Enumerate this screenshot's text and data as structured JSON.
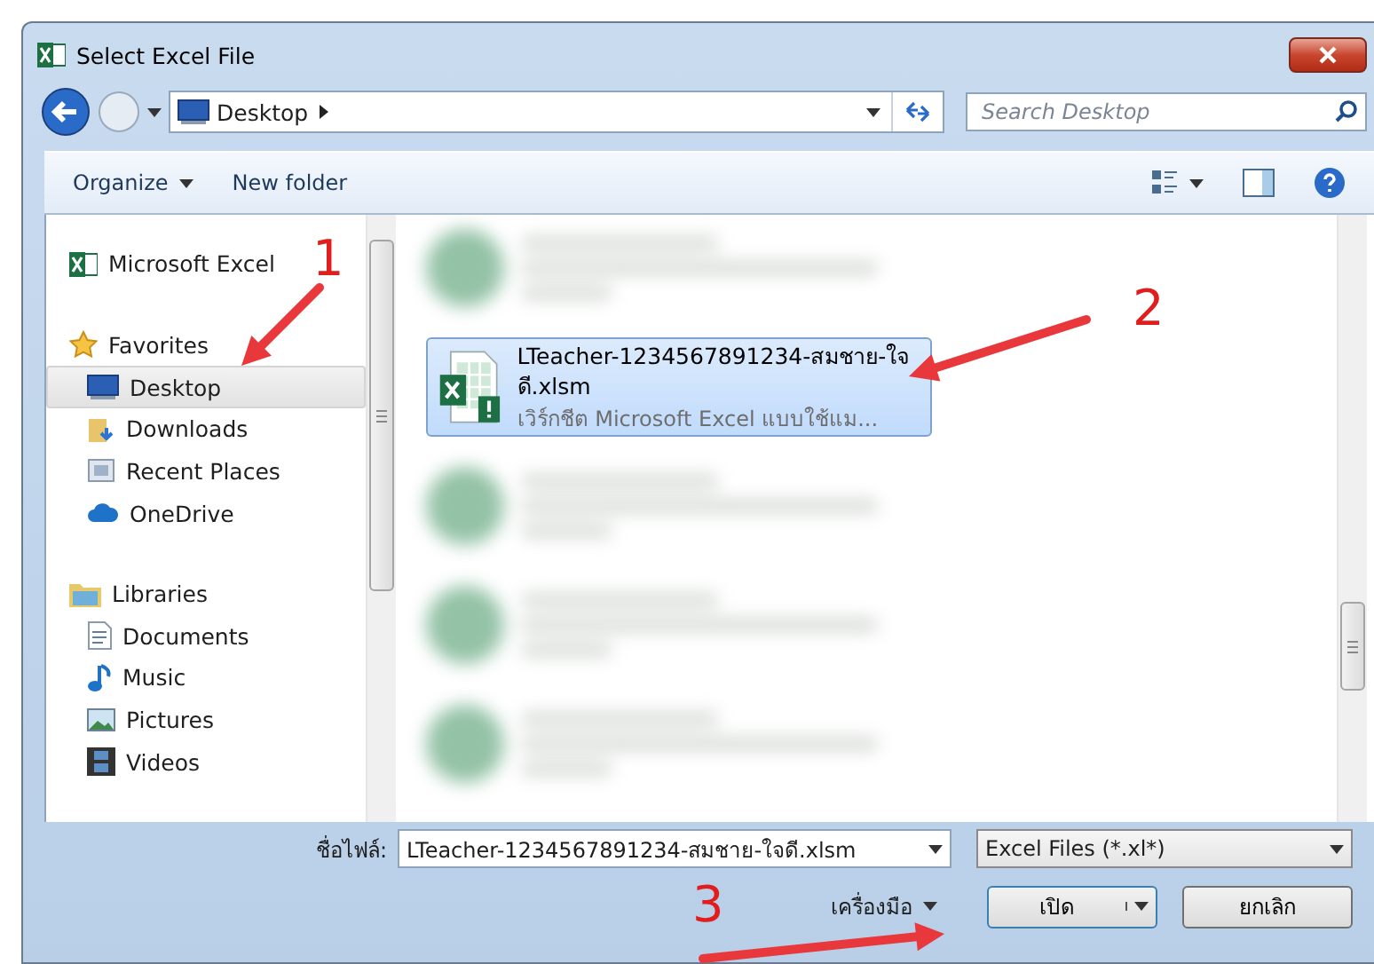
{
  "window": {
    "title": "Select Excel File"
  },
  "address": {
    "path": "Desktop"
  },
  "search": {
    "placeholder": "Search Desktop"
  },
  "toolbar": {
    "organize": "Organize",
    "new_folder": "New folder"
  },
  "sidebar": {
    "items": [
      {
        "label": "Microsoft Excel",
        "kind": "excel",
        "selected": false
      },
      {
        "label": "Favorites",
        "kind": "star",
        "selected": false,
        "children": [
          {
            "label": "Desktop",
            "kind": "desktop",
            "selected": true
          },
          {
            "label": "Downloads",
            "kind": "downloads",
            "selected": false
          },
          {
            "label": "Recent Places",
            "kind": "recent",
            "selected": false
          },
          {
            "label": "OneDrive",
            "kind": "cloud",
            "selected": false
          }
        ]
      },
      {
        "label": "Libraries",
        "kind": "library",
        "selected": false,
        "children": [
          {
            "label": "Documents",
            "kind": "document",
            "selected": false
          },
          {
            "label": "Music",
            "kind": "music",
            "selected": false
          },
          {
            "label": "Pictures",
            "kind": "pictures",
            "selected": false
          },
          {
            "label": "Videos",
            "kind": "videos",
            "selected": false
          }
        ]
      }
    ]
  },
  "files": [
    {
      "kind": "blurred",
      "selected": false
    },
    {
      "kind": "file",
      "name": "LTeacher-1234567891234-สมชาย-ใจดี.xlsm",
      "type": "เวิร์กชีต Microsoft Excel แบบใช้แม...",
      "selected": true
    },
    {
      "kind": "blurred",
      "selected": false
    },
    {
      "kind": "blurred",
      "selected": false
    },
    {
      "kind": "blurred",
      "selected": false
    }
  ],
  "footer": {
    "filename_label": "ชื่อไฟล์:",
    "filename": "LTeacher-1234567891234-สมชาย-ใจดี.xlsm",
    "filter": "Excel Files (*.xl*)",
    "tools": "เครื่องมือ",
    "open": "เปิด",
    "cancel": "ยกเลิก"
  },
  "annotations": [
    {
      "label": "1"
    },
    {
      "label": "2"
    },
    {
      "label": "3"
    }
  ]
}
